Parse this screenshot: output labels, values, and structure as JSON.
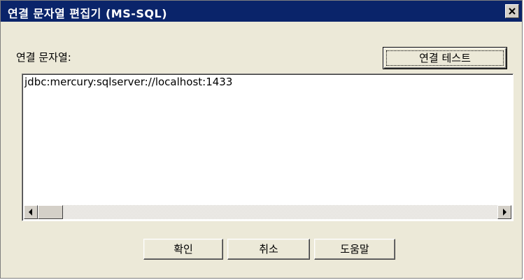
{
  "window": {
    "title": "연결 문자열 편집기 (MS-SQL)",
    "close_icon": "close-icon"
  },
  "form": {
    "connection_string_label": "연결 문자열:",
    "connection_string_value": "jdbc:mercury:sqlserver://localhost:1433",
    "test_button_label": "연결 테스트"
  },
  "footer": {
    "ok_label": "확인",
    "cancel_label": "취소",
    "help_label": "도움말"
  },
  "colors": {
    "titlebar": "#0a246a",
    "dialog_background": "#ece9d8"
  }
}
